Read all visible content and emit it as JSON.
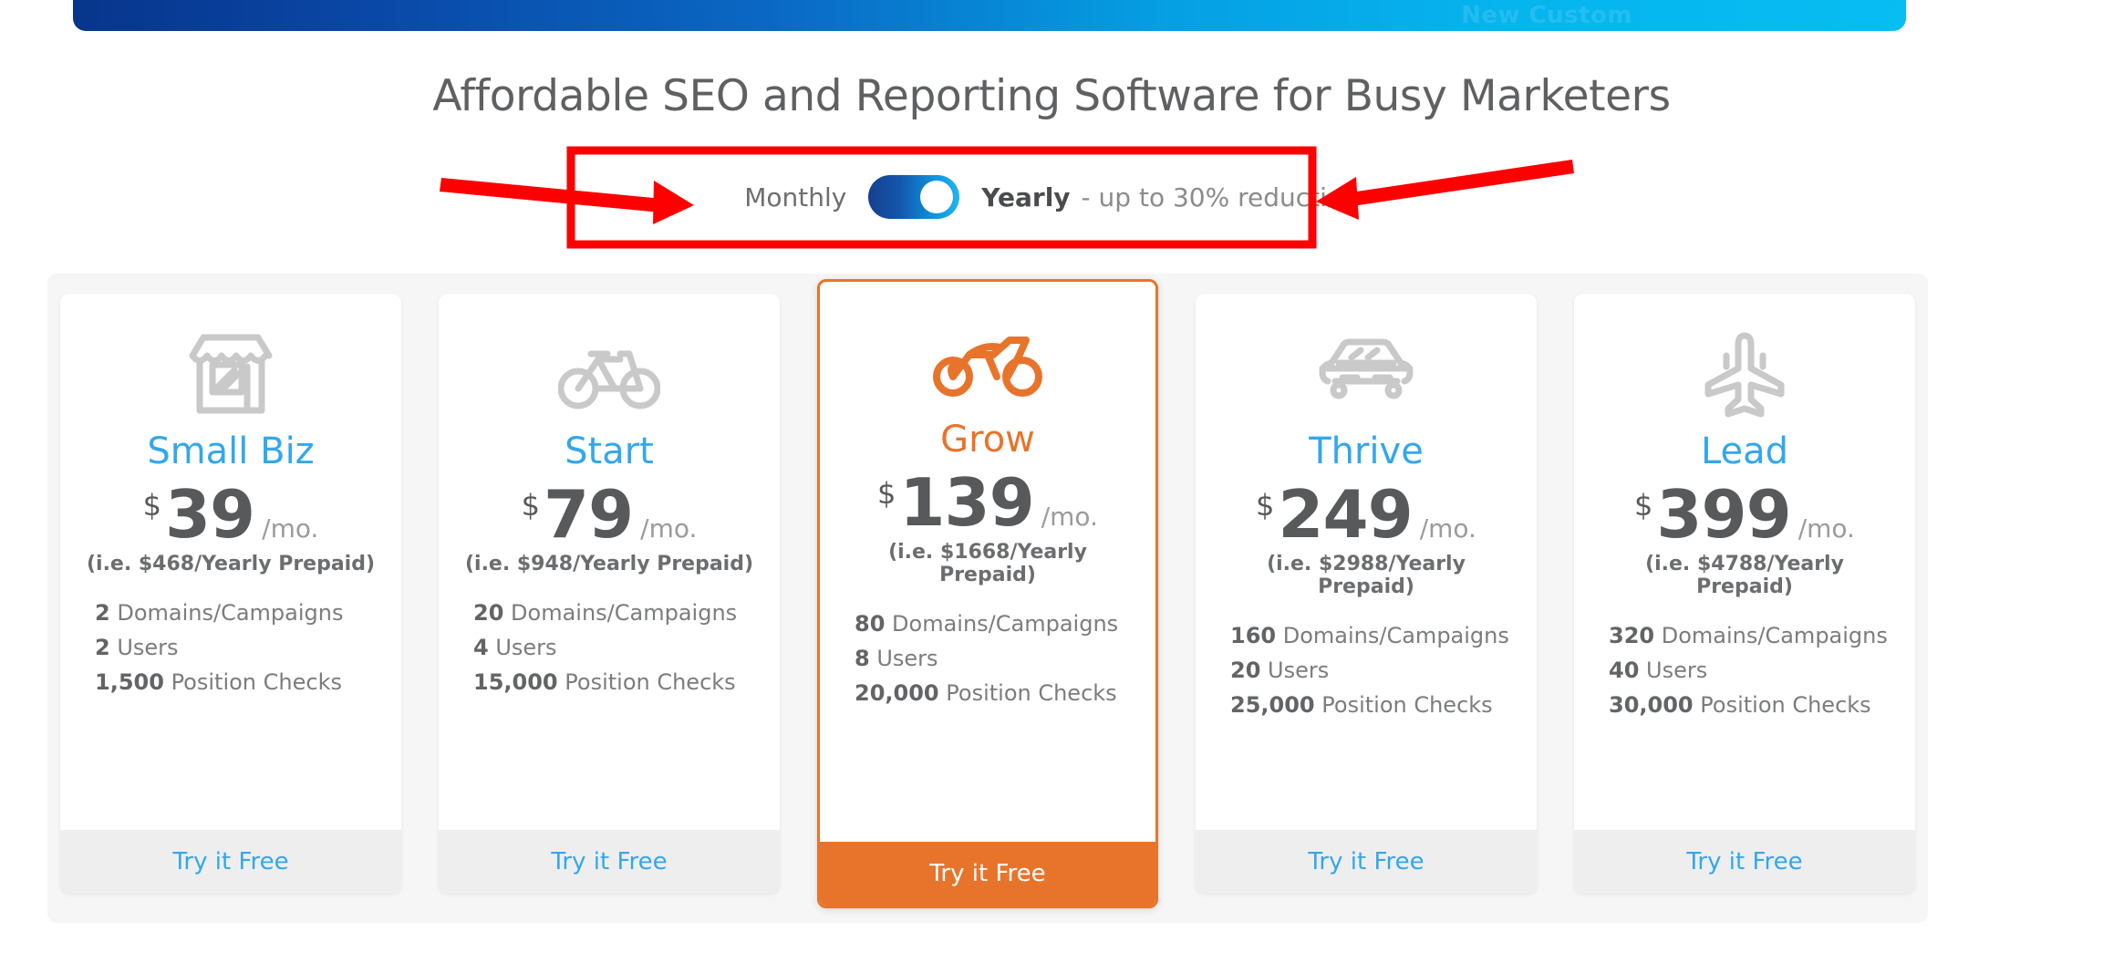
{
  "banner": {
    "partial_text": "New Custom",
    "gradient_start": "#07358c",
    "gradient_end": "#07bdf2"
  },
  "heading": "Affordable SEO and Reporting Software for Busy Marketers",
  "billing_toggle": {
    "monthly_label": "Monthly",
    "yearly_label": "Yearly",
    "discount_note": "- up to 30% reduction",
    "selected": "Yearly",
    "track_gradient_start": "#16408f",
    "track_gradient_end": "#22b4f0"
  },
  "theme": {
    "accent_blue": "#33a7ec",
    "accent_orange": "#e8742c",
    "text_gray": "#58595b",
    "muted_gray": "#7b7c7e",
    "deck_bg": "#f6f6f6",
    "cta_bg": "#eeeeee",
    "annotation_red": "#fd0000"
  },
  "plans": [
    {
      "id": "small-biz",
      "name": "Small Biz",
      "icon": "storefront-icon",
      "featured": false,
      "currency": "$",
      "price": "39",
      "period": "/mo.",
      "yearly_note": "(i.e. $468/Yearly Prepaid)",
      "features": [
        {
          "value": "2",
          "label": "Domains/Campaigns"
        },
        {
          "value": "2",
          "label": "Users"
        },
        {
          "value": "1,500",
          "label": "Position Checks"
        }
      ],
      "cta": "Try it Free"
    },
    {
      "id": "start",
      "name": "Start",
      "icon": "bicycle-icon",
      "featured": false,
      "currency": "$",
      "price": "79",
      "period": "/mo.",
      "yearly_note": "(i.e. $948/Yearly Prepaid)",
      "features": [
        {
          "value": "20",
          "label": "Domains/Campaigns"
        },
        {
          "value": "4",
          "label": "Users"
        },
        {
          "value": "15,000",
          "label": "Position Checks"
        }
      ],
      "cta": "Try it Free"
    },
    {
      "id": "grow",
      "name": "Grow",
      "icon": "motorcycle-icon",
      "featured": true,
      "currency": "$",
      "price": "139",
      "period": "/mo.",
      "yearly_note": "(i.e. $1668/Yearly Prepaid)",
      "features": [
        {
          "value": "80",
          "label": "Domains/Campaigns"
        },
        {
          "value": "8",
          "label": "Users"
        },
        {
          "value": "20,000",
          "label": "Position Checks"
        }
      ],
      "cta": "Try it Free"
    },
    {
      "id": "thrive",
      "name": "Thrive",
      "icon": "car-icon",
      "featured": false,
      "currency": "$",
      "price": "249",
      "period": "/mo.",
      "yearly_note": "(i.e. $2988/Yearly Prepaid)",
      "features": [
        {
          "value": "160",
          "label": "Domains/Campaigns"
        },
        {
          "value": "20",
          "label": "Users"
        },
        {
          "value": "25,000",
          "label": "Position Checks"
        }
      ],
      "cta": "Try it Free"
    },
    {
      "id": "lead",
      "name": "Lead",
      "icon": "airplane-icon",
      "featured": false,
      "currency": "$",
      "price": "399",
      "period": "/mo.",
      "yearly_note": "(i.e. $4788/Yearly Prepaid)",
      "features": [
        {
          "value": "320",
          "label": "Domains/Campaigns"
        },
        {
          "value": "40",
          "label": "Users"
        },
        {
          "value": "30,000",
          "label": "Position Checks"
        }
      ],
      "cta": "Try it Free"
    }
  ]
}
